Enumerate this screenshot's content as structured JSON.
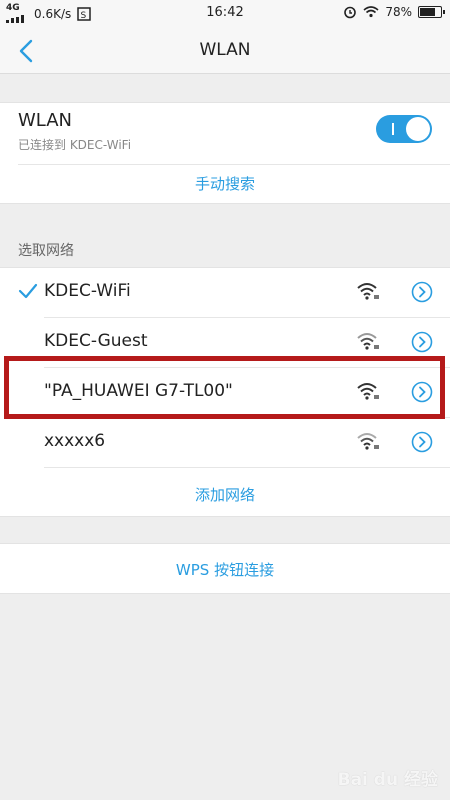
{
  "status_bar": {
    "network_type": "4G",
    "speed": "0.6K/s",
    "time": "16:42",
    "battery_percent": "78%",
    "battery_level": 0.78
  },
  "nav": {
    "title": "WLAN",
    "back_icon": "chevron-left-icon"
  },
  "wlan_card": {
    "label": "WLAN",
    "connected_text": "已连接到 KDEC-WiFi",
    "toggle_on": true,
    "manual_search": "手动搜索"
  },
  "networks_section": {
    "label": "选取网络",
    "items": [
      {
        "ssid": "KDEC-WiFi",
        "connected": true
      },
      {
        "ssid": "KDEC-Guest",
        "connected": false
      },
      {
        "ssid": "\"PA_HUAWEI G7-TL00\"",
        "connected": false
      },
      {
        "ssid": "xxxxx6",
        "connected": false
      }
    ],
    "add_network": "添加网络"
  },
  "wps": {
    "label": "WPS 按钮连接"
  },
  "colors": {
    "accent": "#2a9de0",
    "highlight": "#b51a1a",
    "background": "#eeeeee"
  },
  "watermark": "Bai du 经验"
}
